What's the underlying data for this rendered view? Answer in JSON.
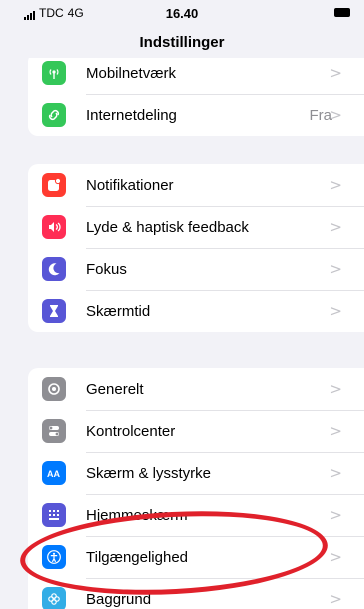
{
  "status_bar": {
    "carrier": "TDC",
    "network": "4G",
    "time": "16.40"
  },
  "nav": {
    "title": "Indstillinger"
  },
  "groups": [
    {
      "items": [
        {
          "label": "Mobilnetværk",
          "icon": "antenna-icon",
          "color": "#34c759",
          "value": ""
        },
        {
          "label": "Internetdeling",
          "icon": "hotspot-icon",
          "color": "#34c759",
          "value": "Fra"
        }
      ]
    },
    {
      "items": [
        {
          "label": "Notifikationer",
          "icon": "bell-icon",
          "color": "#ff3b30",
          "value": ""
        },
        {
          "label": "Lyde & haptisk feedback",
          "icon": "speaker-icon",
          "color": "#ff2d55",
          "value": ""
        },
        {
          "label": "Fokus",
          "icon": "moon-icon",
          "color": "#5856d6",
          "value": ""
        },
        {
          "label": "Skærmtid",
          "icon": "hourglass-icon",
          "color": "#5856d6",
          "value": ""
        }
      ]
    },
    {
      "items": [
        {
          "label": "Generelt",
          "icon": "gear-icon",
          "color": "#8e8e93",
          "value": ""
        },
        {
          "label": "Kontrolcenter",
          "icon": "toggles-icon",
          "color": "#8e8e93",
          "value": ""
        },
        {
          "label": "Skærm & lysstyrke",
          "icon": "text-size-icon",
          "color": "#007aff",
          "value": ""
        },
        {
          "label": "Hjemmeskærm",
          "icon": "home-grid-icon",
          "color": "#5856d6",
          "value": ""
        },
        {
          "label": "Tilgængelighed",
          "icon": "accessibility-icon",
          "color": "#007aff",
          "value": ""
        },
        {
          "label": "Baggrund",
          "icon": "wallpaper-icon",
          "color": "#32ade6",
          "value": ""
        }
      ]
    }
  ],
  "chevron": ">",
  "annotation_color": "#e0212b"
}
